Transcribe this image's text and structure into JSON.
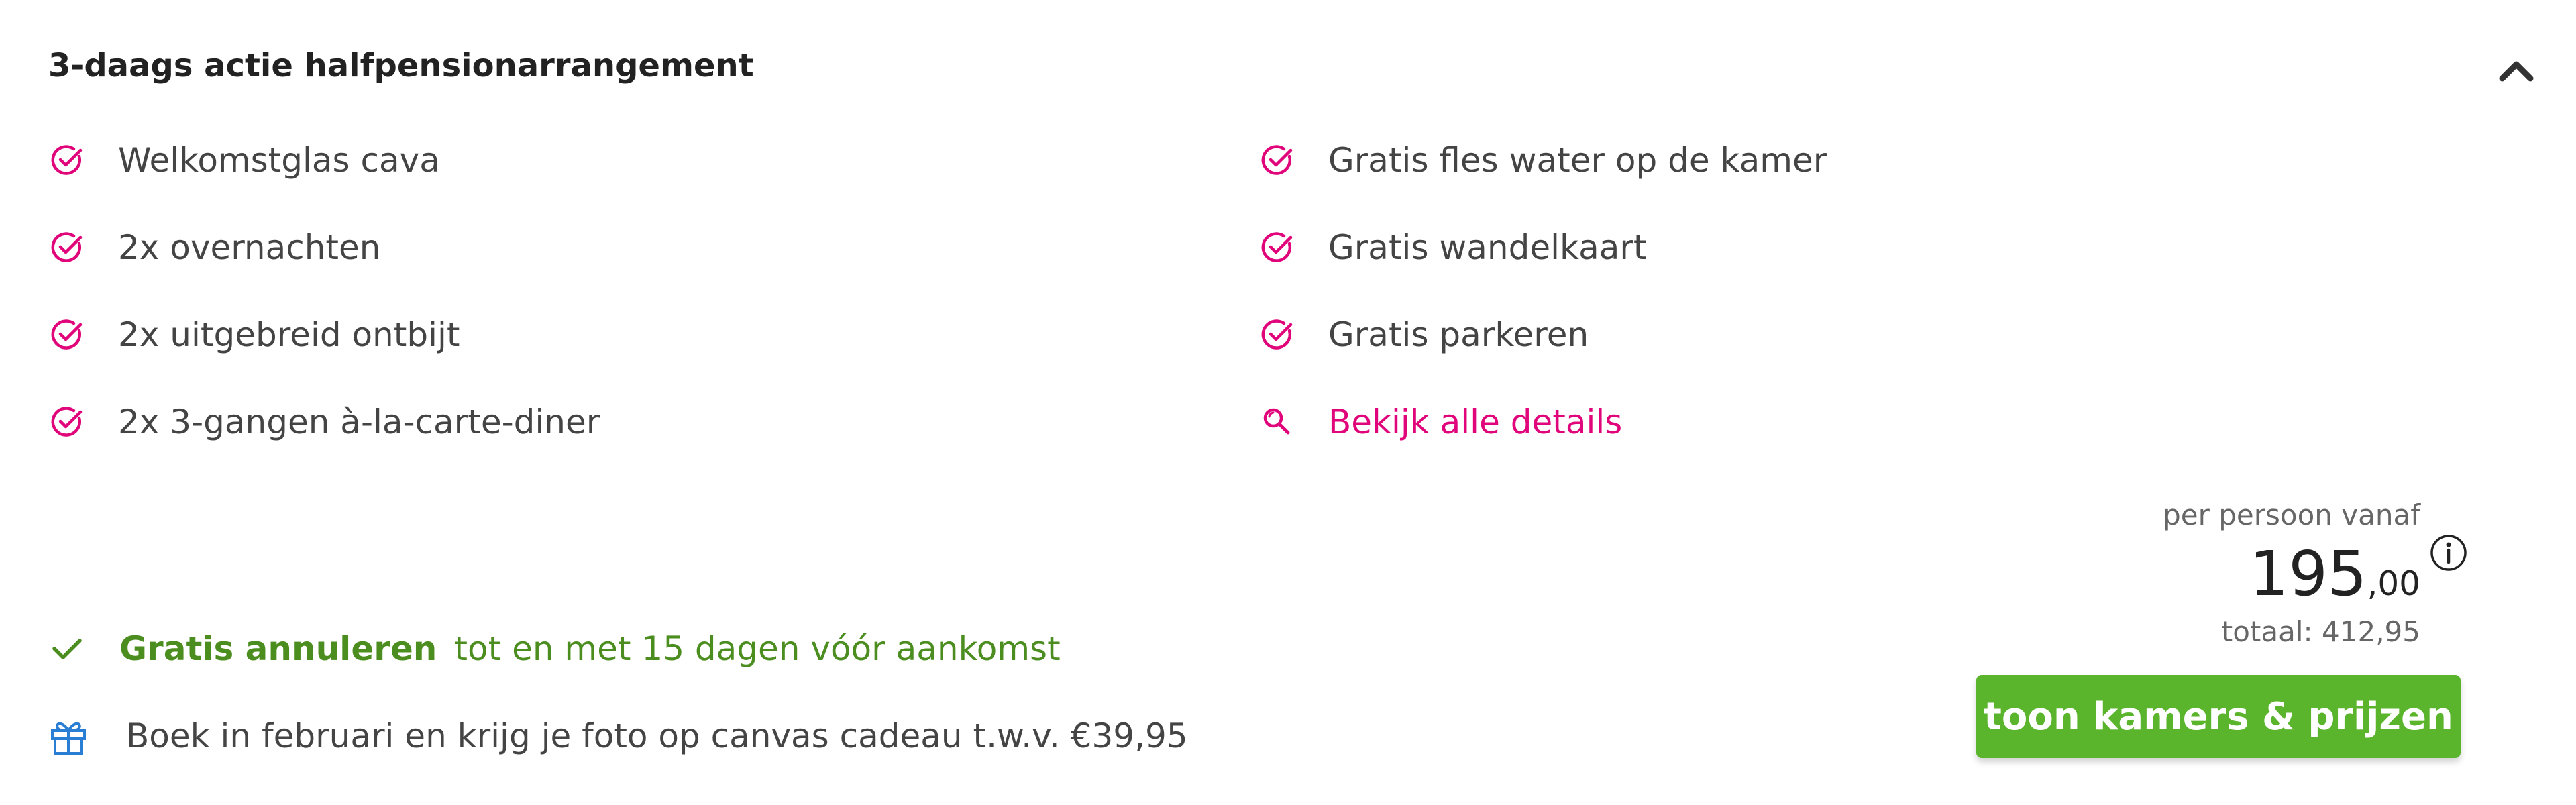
{
  "package": {
    "title": "3-daags actie halfpensionarrangement"
  },
  "features": {
    "left": [
      {
        "label": "Welkomstglas cava",
        "icon": "check-circle-icon"
      },
      {
        "label": "2x overnachten",
        "icon": "check-circle-icon"
      },
      {
        "label": "2x uitgebreid ontbijt",
        "icon": "check-circle-icon"
      },
      {
        "label": "2x 3-gangen à-la-carte-diner",
        "icon": "check-circle-icon"
      }
    ],
    "right": [
      {
        "label": "Gratis fles water op de kamer",
        "icon": "check-circle-icon"
      },
      {
        "label": "Gratis wandelkaart",
        "icon": "check-circle-icon"
      },
      {
        "label": "Gratis parkeren",
        "icon": "check-circle-icon"
      }
    ],
    "details_link": {
      "label": "Bekijk alle details",
      "icon": "magnifier-icon"
    }
  },
  "cancellation": {
    "bold": "Gratis annuleren",
    "text": "tot en met 15 dagen vóór aankomst",
    "icon": "checkmark-icon"
  },
  "promo": {
    "text": "Boek in februari en krijg je foto op canvas cadeau t.w.v. €39,95",
    "icon": "gift-icon"
  },
  "price": {
    "per_person_label": "per persoon vanaf",
    "amount_whole": "195",
    "amount_decimal": ",00",
    "total_label": "totaal: 412,95",
    "info_icon": "info-icon"
  },
  "cta": {
    "label": "toon kamers & prijzen"
  },
  "colors": {
    "accent_pink": "#e0057a",
    "green": "#4c8d1f",
    "button_green": "#5ab52c",
    "gift_blue": "#2a7fd4"
  }
}
